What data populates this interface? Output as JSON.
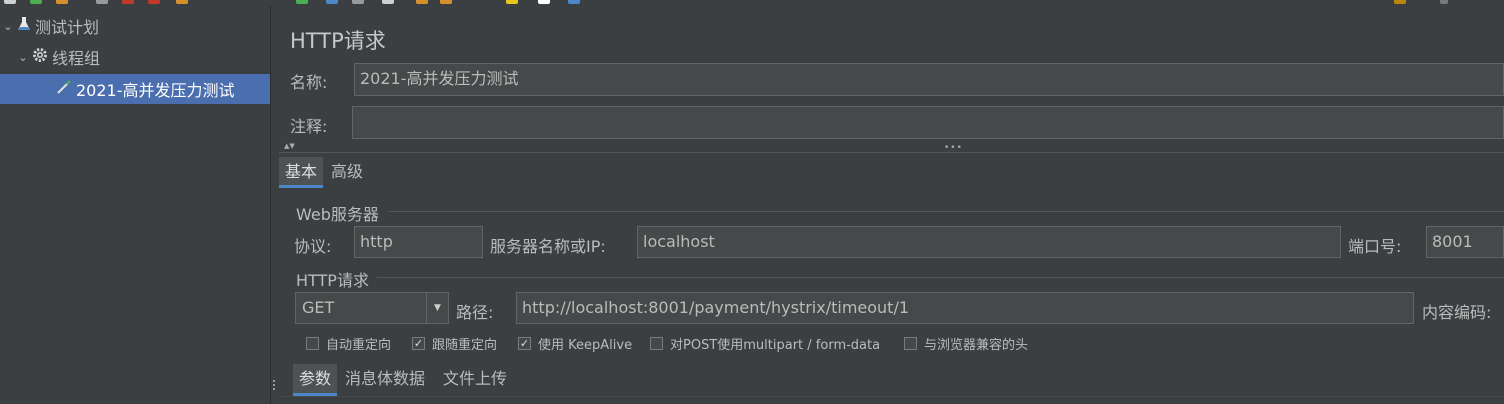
{
  "tree": {
    "items": [
      {
        "label": "测试计划",
        "icon": "flask-icon"
      },
      {
        "label": "线程组",
        "icon": "gear-icon"
      },
      {
        "label": "2021-高并发压力测试",
        "icon": "pipette-icon"
      }
    ]
  },
  "panel": {
    "title": "HTTP请求",
    "name_label": "名称:",
    "name_value": "2021-高并发压力测试",
    "comment_label": "注释:",
    "comment_value": "",
    "tabs": [
      {
        "label": "基本",
        "active": true
      },
      {
        "label": "高级",
        "active": false
      }
    ]
  },
  "web_server": {
    "section_title": "Web服务器",
    "protocol_label": "协议:",
    "protocol_value": "http",
    "server_label": "服务器名称或IP:",
    "server_value": "localhost",
    "port_label": "端口号:",
    "port_value": "8001"
  },
  "http_request": {
    "section_title": "HTTP请求",
    "method_value": "GET",
    "path_label": "路径:",
    "path_value": "http://localhost:8001/payment/hystrix/timeout/1",
    "encoding_label": "内容编码:",
    "options": [
      {
        "label": "自动重定向",
        "checked": false
      },
      {
        "label": "跟随重定向",
        "checked": true
      },
      {
        "label": "使用 KeepAlive",
        "checked": true
      },
      {
        "label": "对POST使用multipart / form-data",
        "checked": false
      },
      {
        "label": "与浏览器兼容的头",
        "checked": false
      }
    ]
  },
  "bottom_tabs": [
    {
      "label": "参数",
      "active": true
    },
    {
      "label": "消息体数据",
      "active": false
    },
    {
      "label": "文件上传",
      "active": false
    }
  ],
  "colors": {
    "background": "#3c3f41",
    "selection": "#4b6eaf",
    "field_bg": "#45494a",
    "text": "#bbbbbb"
  }
}
